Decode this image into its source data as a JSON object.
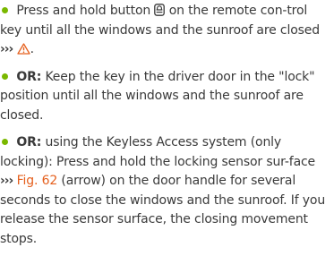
{
  "bullet_color": "#7ab800",
  "link_color": "#e5601e",
  "warning_color": "#e5601e",
  "paragraphs": [
    {
      "lead": "",
      "text_1": "Press and hold button",
      "icon": "lock-button-icon",
      "text_2": "on the remote con-trol key until all the windows and the sunroof are closed",
      "ref_arrows": "›››",
      "warning_icon": "warning-triangle-icon",
      "text_3": "."
    },
    {
      "lead": "OR:",
      "text": "Keep the key in the driver door in the \"lock\" position until all the windows and the sunroof are closed."
    },
    {
      "lead": "OR:",
      "text_1": "using the Keyless Access system (only locking): Press and hold the locking sensor sur-face",
      "ref_arrows": "›››",
      "fig_ref": "Fig. 62",
      "text_2": "(arrow) on the door handle for several seconds to close the windows and the sunroof. If you release the sensor surface, the closing movement stops."
    }
  ]
}
